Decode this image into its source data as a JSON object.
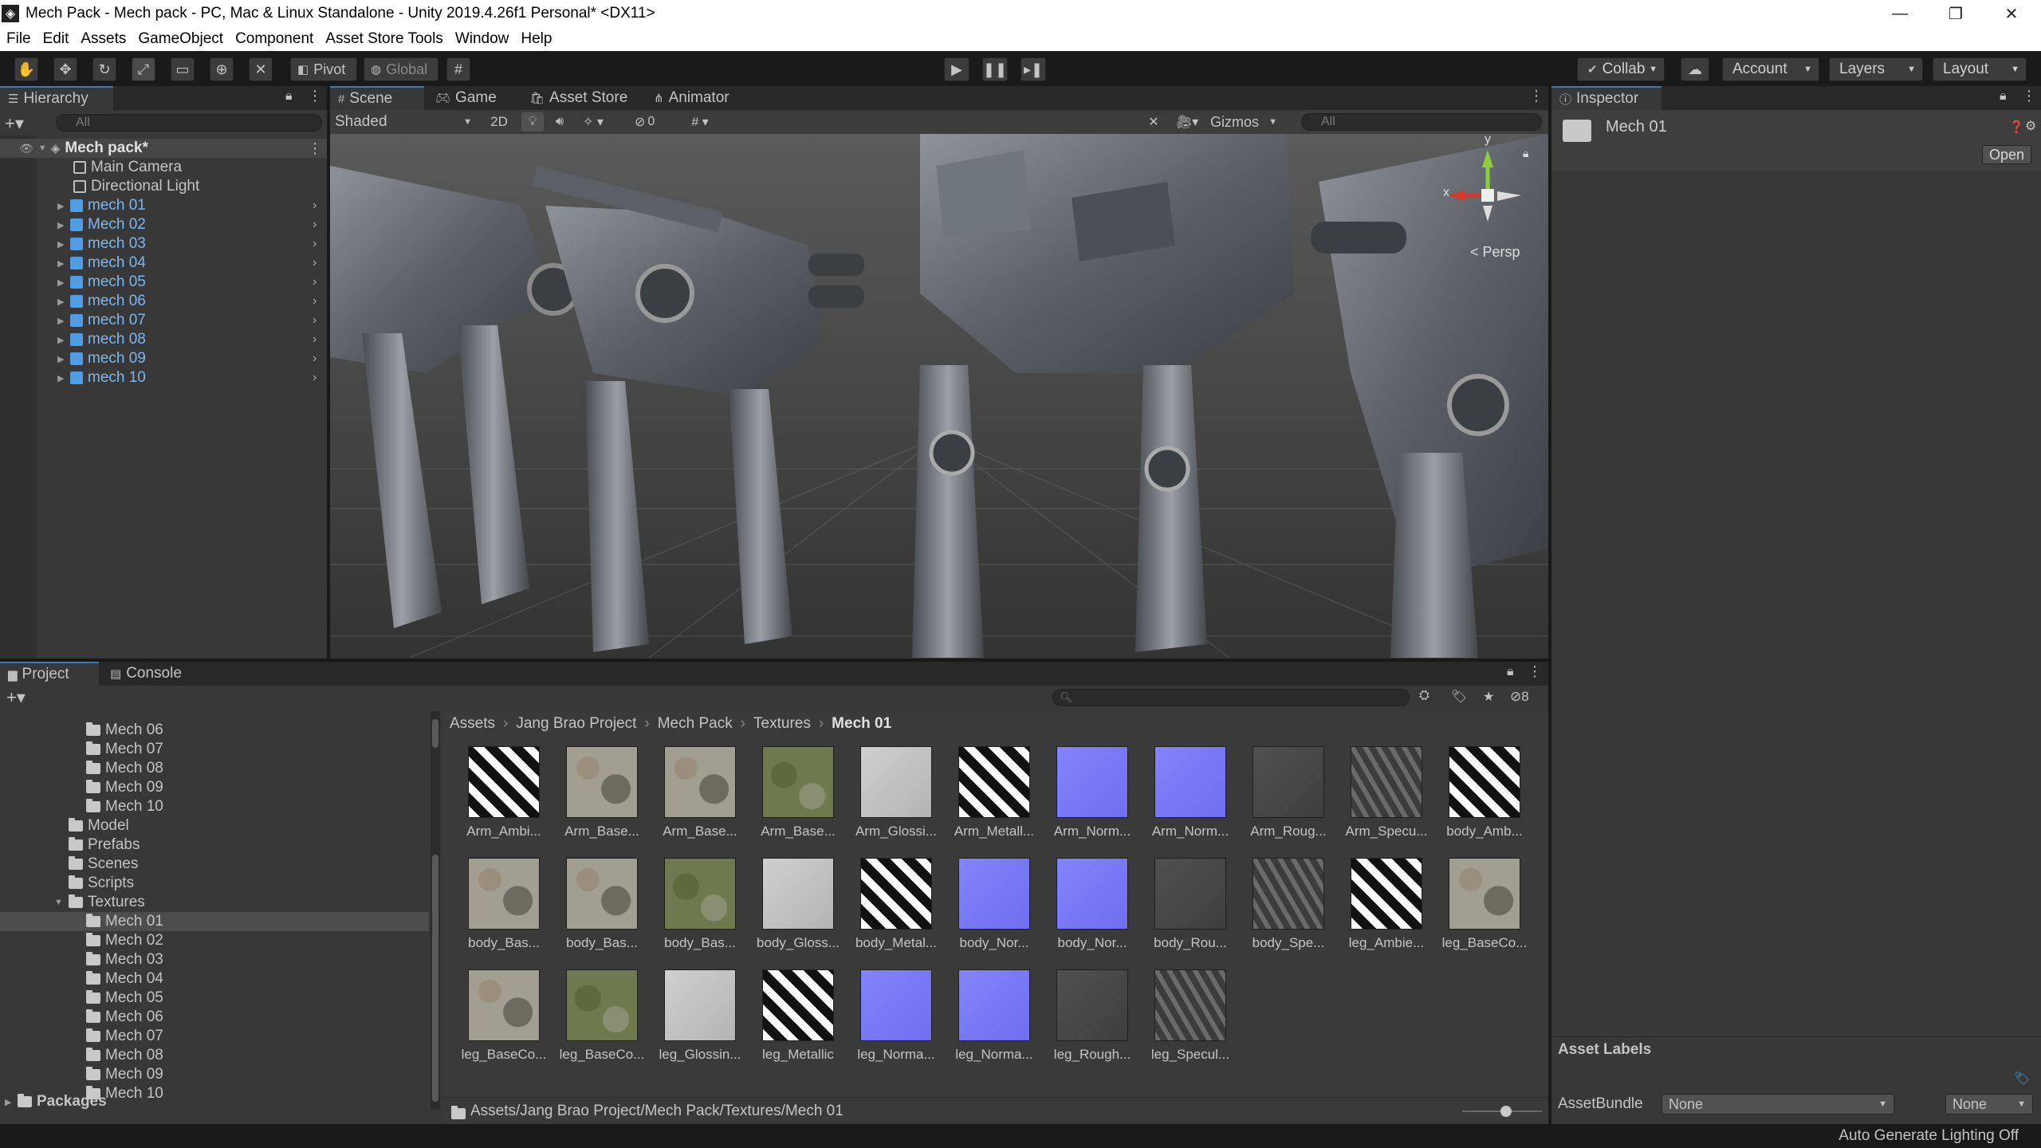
{
  "window": {
    "title": "Mech Pack - Mech pack - PC, Mac & Linux Standalone - Unity 2019.4.26f1 Personal* <DX11>",
    "minimize": "—",
    "restore": "❐",
    "close": "✕"
  },
  "menu": [
    "File",
    "Edit",
    "Assets",
    "GameObject",
    "Component",
    "Asset Store Tools",
    "Window",
    "Help"
  ],
  "toolbar": {
    "pivot": "Pivot",
    "global": "Global",
    "collab": "Collab",
    "account": "Account",
    "layers": "Layers",
    "layout": "Layout"
  },
  "hierarchy": {
    "tab": "Hierarchy",
    "search_placeholder": "All",
    "scene_name": "Mech pack*",
    "items": [
      "Main Camera",
      "Directional Light",
      "mech 01",
      "Mech 02",
      "mech 03",
      "mech 04",
      "mech 05",
      "mech 06",
      "mech 07",
      "mech 08",
      "mech 09",
      "mech 10"
    ]
  },
  "scene_view": {
    "tabs": [
      "Scene",
      "Game",
      "Asset Store",
      "Animator"
    ],
    "shading": "Shaded",
    "mode_2d": "2D",
    "hidden_count": "0",
    "gizmos": "Gizmos",
    "search_placeholder": "All",
    "persp": "< Persp",
    "axis_x": "x",
    "axis_y": "y"
  },
  "inspector": {
    "tab": "Inspector",
    "object_name": "Mech 01",
    "open_button": "Open",
    "asset_labels": "Asset Labels",
    "assetbundle_label": "AssetBundle",
    "assetbundle_value": "None",
    "assetbundle_variant": "None"
  },
  "project": {
    "tabs": [
      "Project",
      "Console"
    ],
    "hidden_count": "8",
    "tree": [
      {
        "label": "Mech 06",
        "indent": 4,
        "folder": true
      },
      {
        "label": "Mech 07",
        "indent": 4,
        "folder": true
      },
      {
        "label": "Mech 08",
        "indent": 4,
        "folder": true
      },
      {
        "label": "Mech 09",
        "indent": 4,
        "folder": true
      },
      {
        "label": "Mech 10",
        "indent": 4,
        "folder": true
      },
      {
        "label": "Model",
        "indent": 3,
        "folder": true
      },
      {
        "label": "Prefabs",
        "indent": 3,
        "folder": true
      },
      {
        "label": "Scenes",
        "indent": 3,
        "folder": true
      },
      {
        "label": "Scripts",
        "indent": 3,
        "folder": true
      },
      {
        "label": "Textures",
        "indent": 3,
        "folder": true,
        "open": true
      },
      {
        "label": "Mech 01",
        "indent": 4,
        "folder": true,
        "selected": true
      },
      {
        "label": "Mech 02",
        "indent": 4,
        "folder": true
      },
      {
        "label": "Mech 03",
        "indent": 4,
        "folder": true
      },
      {
        "label": "Mech 04",
        "indent": 4,
        "folder": true
      },
      {
        "label": "Mech 05",
        "indent": 4,
        "folder": true
      },
      {
        "label": "Mech 06",
        "indent": 4,
        "folder": true
      },
      {
        "label": "Mech 07",
        "indent": 4,
        "folder": true
      },
      {
        "label": "Mech 08",
        "indent": 4,
        "folder": true
      },
      {
        "label": "Mech 09",
        "indent": 4,
        "folder": true
      },
      {
        "label": "Mech 10",
        "indent": 4,
        "folder": true
      }
    ],
    "packages": "Packages",
    "breadcrumb": [
      "Assets",
      "Jang Brao Project",
      "Mech Pack",
      "Textures",
      "Mech 01"
    ],
    "path": "Assets/Jang Brao Project/Mech Pack/Textures/Mech 01",
    "assets": [
      {
        "label": "Arm_Ambi...",
        "kind": "mask"
      },
      {
        "label": "Arm_Base...",
        "kind": "camo"
      },
      {
        "label": "Arm_Base...",
        "kind": "camo"
      },
      {
        "label": "Arm_Base...",
        "kind": "green"
      },
      {
        "label": "Arm_Glossi...",
        "kind": "gloss"
      },
      {
        "label": "Arm_Metall...",
        "kind": "mask"
      },
      {
        "label": "Arm_Norm...",
        "kind": "normal"
      },
      {
        "label": "Arm_Norm...",
        "kind": "normal"
      },
      {
        "label": "Arm_Roug...",
        "kind": "rough"
      },
      {
        "label": "Arm_Specu...",
        "kind": "spec"
      },
      {
        "label": "body_Amb...",
        "kind": "mask"
      },
      {
        "label": "body_Bas...",
        "kind": "camo"
      },
      {
        "label": "body_Bas...",
        "kind": "camo"
      },
      {
        "label": "body_Bas...",
        "kind": "green"
      },
      {
        "label": "body_Gloss...",
        "kind": "gloss"
      },
      {
        "label": "body_Metal...",
        "kind": "mask"
      },
      {
        "label": "body_Nor...",
        "kind": "normal"
      },
      {
        "label": "body_Nor...",
        "kind": "normal"
      },
      {
        "label": "body_Rou...",
        "kind": "rough"
      },
      {
        "label": "body_Spe...",
        "kind": "spec"
      },
      {
        "label": "leg_Ambie...",
        "kind": "mask"
      },
      {
        "label": "leg_BaseCo...",
        "kind": "camo"
      },
      {
        "label": "leg_BaseCo...",
        "kind": "camo"
      },
      {
        "label": "leg_BaseCo...",
        "kind": "green"
      },
      {
        "label": "leg_Glossin...",
        "kind": "gloss"
      },
      {
        "label": "leg_Metallic",
        "kind": "mask"
      },
      {
        "label": "leg_Norma...",
        "kind": "normal"
      },
      {
        "label": "leg_Norma...",
        "kind": "normal"
      },
      {
        "label": "leg_Rough...",
        "kind": "rough"
      },
      {
        "label": "leg_Specul...",
        "kind": "spec"
      }
    ]
  },
  "statusbar": {
    "text": "Auto Generate Lighting Off"
  },
  "colors": {
    "accent": "#3a79bb",
    "prefab_blue": "#4f9ee3",
    "normal_map": "#7b7bf5",
    "panel": "#383838"
  }
}
